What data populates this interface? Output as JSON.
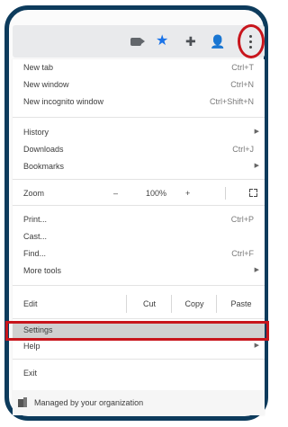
{
  "toolbar": {
    "icons": [
      "video-icon",
      "star-icon",
      "puzzle-icon",
      "profile-icon",
      "kebab-menu-icon"
    ],
    "star_color": "#1a73e8"
  },
  "highlight_color": "#c8151c",
  "menu": {
    "new_tab": {
      "label": "New tab",
      "shortcut": "Ctrl+T"
    },
    "new_window": {
      "label": "New window",
      "shortcut": "Ctrl+N"
    },
    "new_incognito": {
      "label": "New incognito window",
      "shortcut": "Ctrl+Shift+N"
    },
    "history": {
      "label": "History"
    },
    "downloads": {
      "label": "Downloads",
      "shortcut": "Ctrl+J"
    },
    "bookmarks": {
      "label": "Bookmarks"
    },
    "zoom": {
      "label": "Zoom",
      "minus": "–",
      "value": "100%",
      "plus": "+"
    },
    "print": {
      "label": "Print...",
      "shortcut": "Ctrl+P"
    },
    "cast": {
      "label": "Cast..."
    },
    "find": {
      "label": "Find...",
      "shortcut": "Ctrl+F"
    },
    "more_tools": {
      "label": "More tools"
    },
    "edit": {
      "label": "Edit",
      "cut": "Cut",
      "copy": "Copy",
      "paste": "Paste"
    },
    "settings": {
      "label": "Settings"
    },
    "help": {
      "label": "Help"
    },
    "exit": {
      "label": "Exit"
    },
    "managed": {
      "label": "Managed by your organization"
    }
  }
}
